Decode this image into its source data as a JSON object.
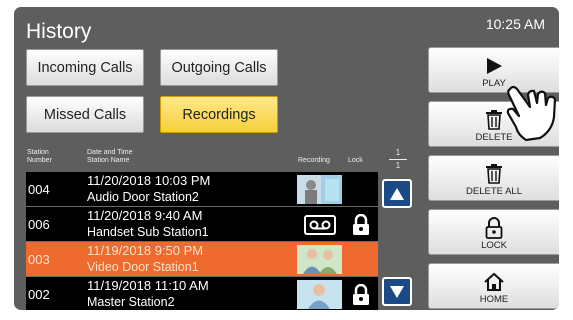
{
  "header": {
    "title": "History",
    "time": "10:25 AM"
  },
  "filters": [
    {
      "label": "Incoming Calls",
      "active": false
    },
    {
      "label": "Outgoing Calls",
      "active": false
    },
    {
      "label": "Missed Calls",
      "active": false
    },
    {
      "label": "Recordings",
      "active": true
    }
  ],
  "table": {
    "headers": {
      "station_number": "Station\nNumber",
      "date_time": "Date and Time\nStation Name",
      "recording": "Recording",
      "lock": "Lock"
    },
    "rows": [
      {
        "number": "004",
        "datetime": "11/20/2018 10:03 PM",
        "station": "Audio Door Station2",
        "recording": "image",
        "locked": false,
        "selected": false
      },
      {
        "number": "006",
        "datetime": "11/20/2018  9:40 AM",
        "station": "Handset Sub Station1",
        "recording": "tape",
        "locked": true,
        "selected": false
      },
      {
        "number": "003",
        "datetime": "11/19/2018  9:50 PM",
        "station": "Video Door Station1",
        "recording": "image",
        "locked": false,
        "selected": true
      },
      {
        "number": "002",
        "datetime": "11/19/2018 11:10 AM",
        "station": "Master Station2",
        "recording": "image",
        "locked": true,
        "selected": false
      }
    ]
  },
  "pagination": {
    "current": "1",
    "total": "1"
  },
  "actions": {
    "play": "PLAY",
    "delete": "DELETE",
    "delete_all": "DELETE ALL",
    "lock": "LOCK",
    "home": "HOME"
  },
  "icons": {
    "play": "play-icon",
    "delete": "trash-icon",
    "delete_all": "trash-icon",
    "lock": "padlock-icon",
    "home": "home-icon",
    "scroll_up": "up-triangle-icon",
    "scroll_down": "down-triangle-icon",
    "recording_tape": "tape-icon",
    "pointer": "pointing-hand-icon"
  },
  "colors": {
    "panel": "#5e5e5e",
    "selected_row": "#ef6a2e",
    "active_filter": "#f5cf3b",
    "scroll_button": "#1b4a87"
  }
}
